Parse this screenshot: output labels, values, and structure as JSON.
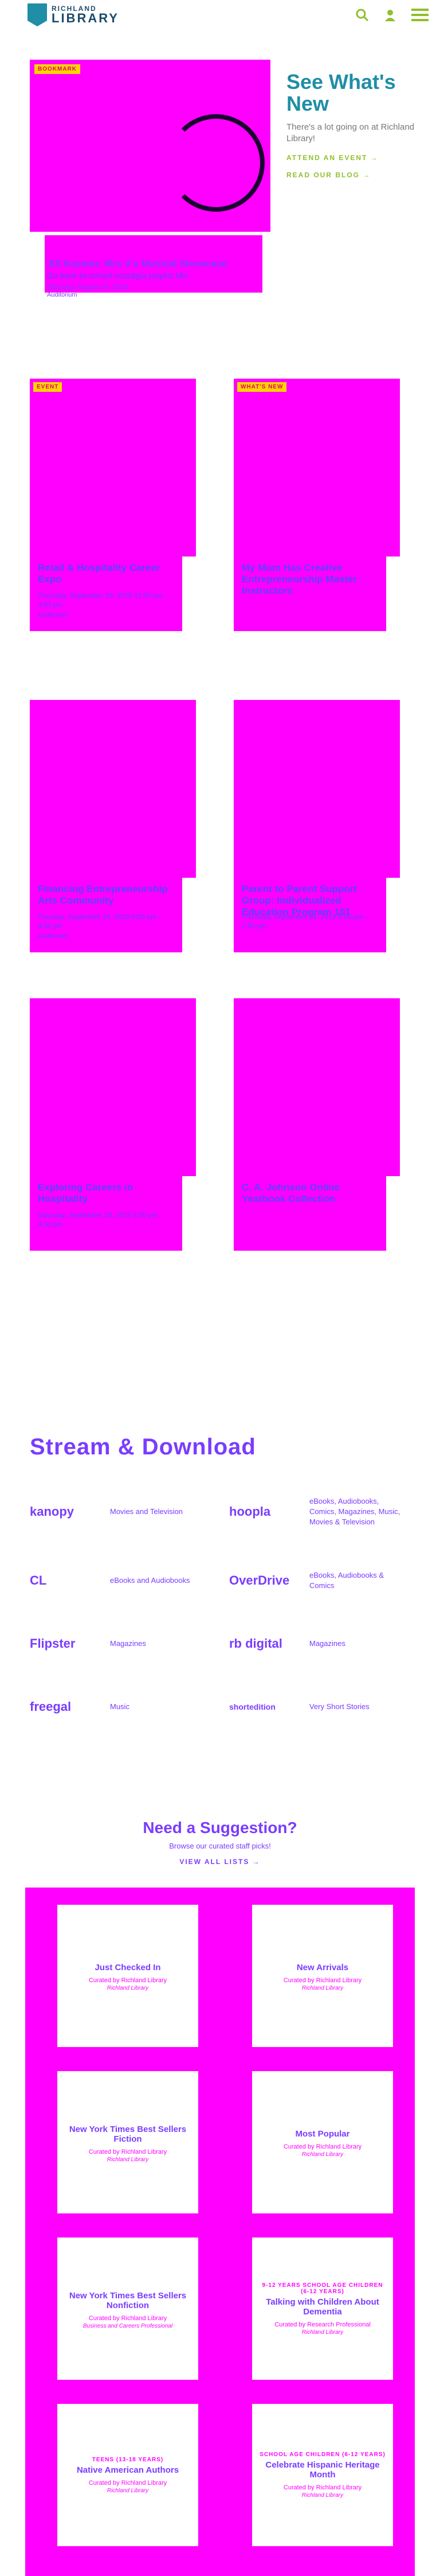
{
  "header": {
    "logo_line1": "RICHLAND",
    "logo_line2": "LIBRARY",
    "colors": {
      "brand": "#1f8ea6",
      "accent": "#8fbf2b"
    },
    "icons": [
      "search-icon",
      "user-icon",
      "menu-icon"
    ]
  },
  "hero": {
    "tag": "BOOKMARK",
    "title": "Jill Kasmin: Mrs V's Musical Showcase",
    "subtitle": "Go back-to-school nostalgia playlist Mix",
    "meta": "Saturday, August 24, 2019",
    "location": "Auditorium"
  },
  "whats_new": {
    "heading": "See What's New",
    "body": "There's a lot going on at Richland Library!",
    "event_link": "ATTEND AN EVENT →",
    "blog_link": "READ OUR BLOG →"
  },
  "cards": [
    {
      "tag": "EVENT",
      "title": "Retail & Hospitality Career Expo",
      "date": "Thursday, September 19, 2019 12:00 pm - 4:00 pm",
      "location": "Auditorium"
    },
    {
      "tag": "WHAT'S NEW",
      "title": "My Mom Has Creative Entrepreneurship Master Instructors",
      "date": "",
      "location": ""
    },
    {
      "tag": "",
      "title": "Financing Entrepreneurship Arts Community",
      "date": "Tuesday, September 24, 2019 6:00 pm - 8:00 pm",
      "location": "Auditorium"
    },
    {
      "tag": "",
      "title": "Parent to Parent Support Group: Individualized Education Program 101",
      "date": "Thursday, September 26, 2019 6:00 pm - 7:00 pm",
      "location": ""
    },
    {
      "tag": "",
      "title": "Exploring Careers in Hospitality",
      "date": "Saturday, September 28, 2019 2:00 pm - 4:30 pm",
      "location": ""
    },
    {
      "tag": "",
      "title": "C. A. Johnson Online Yearbook Collection",
      "date": "",
      "location": ""
    }
  ],
  "stream": {
    "heading": "Stream & Download",
    "services": [
      {
        "name": "kanopy",
        "desc": "Movies and Television"
      },
      {
        "name": "hoopla",
        "desc": "eBooks, Audiobooks, Comics, Magazines, Music, Movies & Television"
      },
      {
        "name": "CL",
        "desc": "eBooks and Audiobooks"
      },
      {
        "name": "OverDrive",
        "desc": "eBooks, Audiobooks & Comics"
      },
      {
        "name": "Flipster",
        "desc": "Magazines"
      },
      {
        "name": "rb digital",
        "desc": "Magazines"
      },
      {
        "name": "freegal",
        "desc": "Music"
      },
      {
        "name": "shortedition",
        "desc": "Very Short Stories"
      }
    ]
  },
  "suggestions": {
    "heading": "Need a Suggestion?",
    "sub": "Browse our curated staff picks!",
    "link": "VIEW ALL LISTS →",
    "lists": [
      {
        "kicker": "",
        "title": "Just Checked In",
        "curator": "Curated by Richland Library",
        "org": "Richland Library"
      },
      {
        "kicker": "",
        "title": "New Arrivals",
        "curator": "Curated by Richland Library",
        "org": "Richland Library"
      },
      {
        "kicker": "",
        "title": "New York Times Best Sellers Fiction",
        "curator": "Curated by Richland Library",
        "org": "Richland Library"
      },
      {
        "kicker": "",
        "title": "Most Popular",
        "curator": "Curated by Richland Library",
        "org": "Richland Library"
      },
      {
        "kicker": "",
        "title": "New York Times Best Sellers Nonfiction",
        "curator": "Curated by Richland Library",
        "org": "Business and Careers Professional"
      },
      {
        "kicker": "9-12 YEARS  SCHOOL AGE CHILDREN (6-12 YEARS)",
        "title": "Talking with Children About Dementia",
        "curator": "Curated by Research Professional",
        "org": "Richland Library"
      },
      {
        "kicker": "TEENS (13-18 YEARS)",
        "title": "Native American Authors",
        "curator": "Curated by Richland Library",
        "org": "Richland Library"
      },
      {
        "kicker": "SCHOOL AGE CHILDREN (6-12 YEARS)",
        "title": "Celebrate Hispanic Heritage Month",
        "curator": "Curated by Richland Library",
        "org": "Richland Library"
      }
    ]
  }
}
